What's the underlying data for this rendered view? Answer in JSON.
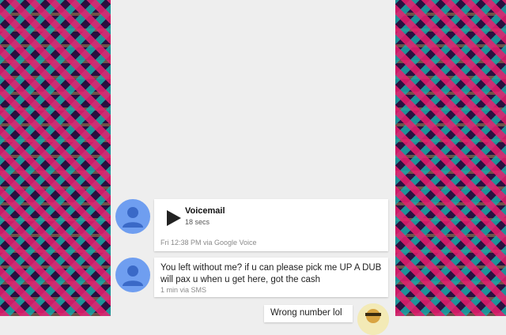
{
  "thread": {
    "voicemail": {
      "title": "Voicemail",
      "duration": "18 secs",
      "meta": "Fri 12:38 PM via Google Voice",
      "avatar_icon": "person-icon",
      "play_icon": "play-icon"
    },
    "incoming_sms": {
      "text": "You left without me? if u can please pick me UP A DUB will pax u when u get here, got the cash",
      "meta": "1 min via SMS",
      "avatar_icon": "person-icon"
    },
    "outgoing_sms": {
      "text": "Wrong number lol"
    }
  },
  "colors": {
    "avatar_blue": "#6f9ef0",
    "avatar_figure": "#3a69c7",
    "background": "#eeeeee",
    "pattern_pink": "#e81e6e",
    "pattern_teal": "#1ca8a8",
    "pattern_dark": "#2a1140"
  }
}
